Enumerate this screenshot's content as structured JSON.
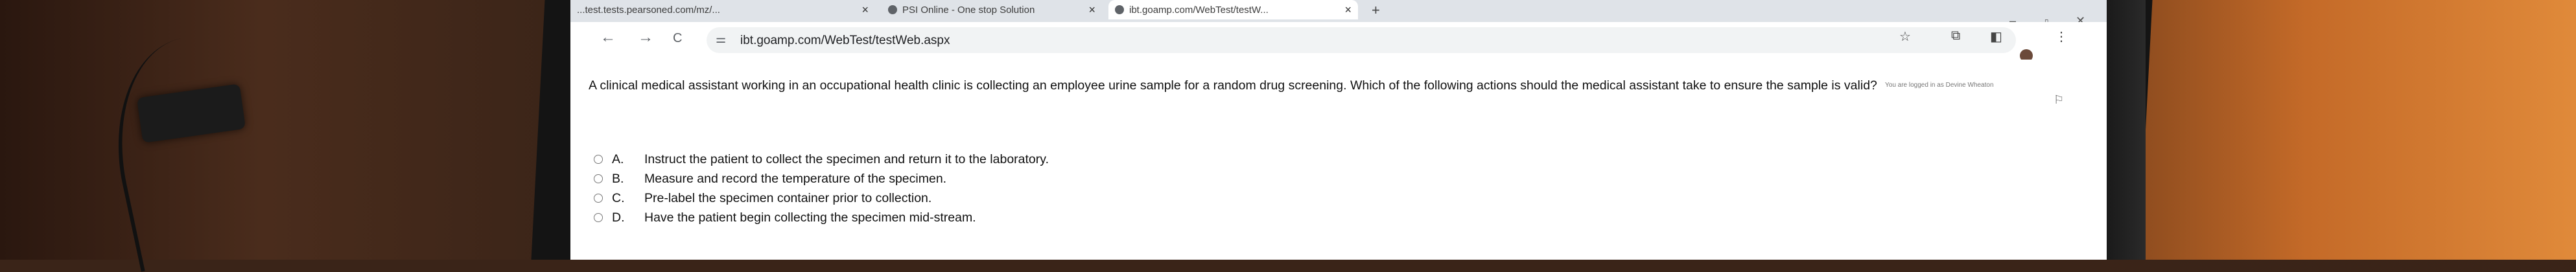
{
  "browser": {
    "tabs": [
      {
        "label": "...test.tests.pearsoned.com/mz/..."
      },
      {
        "label": "PSI Online - One stop Solution"
      },
      {
        "label": "ibt.goamp.com/WebTest/testW..."
      }
    ],
    "new_tab_label": "+",
    "url": "ibt.goamp.com/WebTest/testWeb.aspx",
    "nav": {
      "back": "←",
      "forward": "→",
      "reload": "C"
    }
  },
  "page": {
    "login_note": "You are logged in as Devine Wheaton",
    "question": "A clinical medical assistant working in an occupational health clinic is collecting an employee urine sample for a random drug screening. Which of the following actions should the medical assistant take to ensure the sample is valid?",
    "choices": [
      {
        "letter": "A.",
        "text": "Instruct the patient to collect the specimen and return it to the laboratory."
      },
      {
        "letter": "B.",
        "text": "Measure and record the temperature of the specimen."
      },
      {
        "letter": "C.",
        "text": "Pre-label the specimen container prior to collection."
      },
      {
        "letter": "D.",
        "text": "Have the patient begin collecting the specimen mid-stream."
      }
    ]
  }
}
